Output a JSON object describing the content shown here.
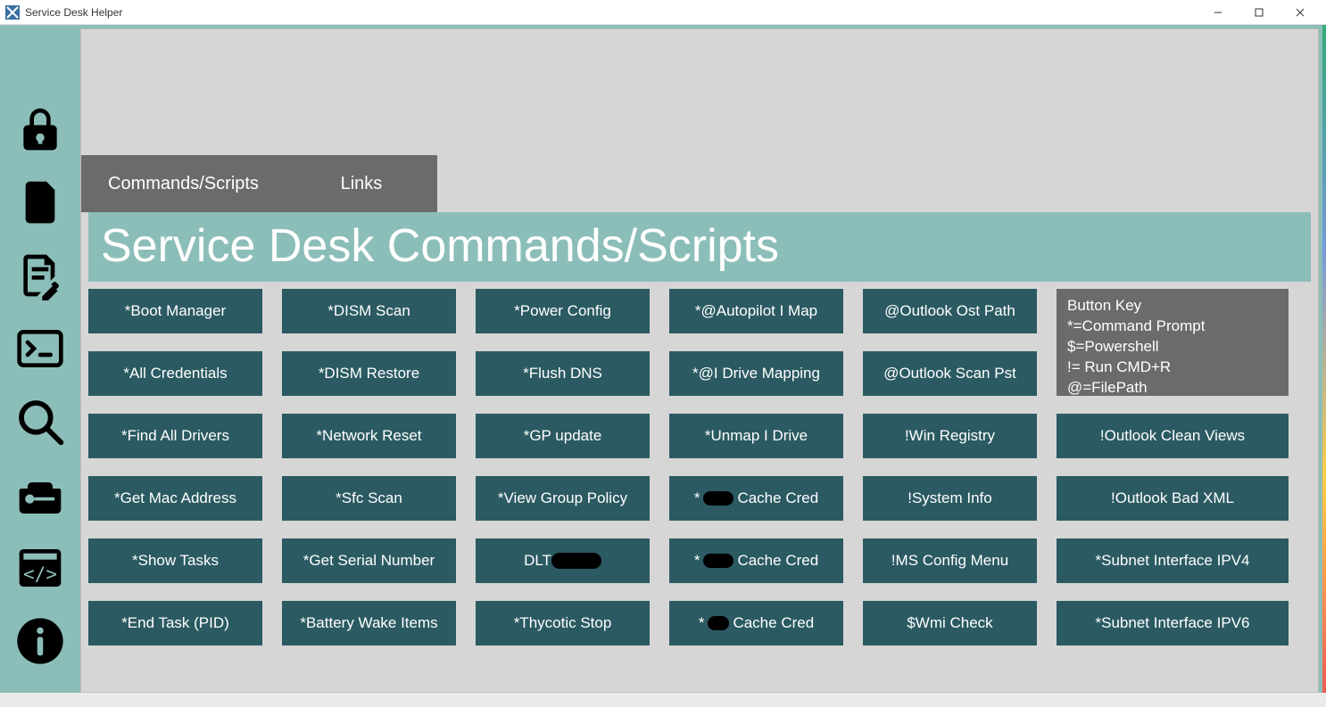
{
  "window": {
    "title": "Service Desk Helper"
  },
  "tabs": {
    "commands": "Commands/Scripts",
    "links": "Links"
  },
  "page": {
    "title": "Service Desk Commands/Scripts"
  },
  "key": {
    "heading": "Button Key",
    "l1": "*=Command Prompt",
    "l2": "$=Powershell",
    "l3": "!= Run CMD+R",
    "l4": "@=FilePath"
  },
  "cols": {
    "c1": [
      "*Boot Manager",
      "*All Credentials",
      "*Find All Drivers",
      "*Get Mac Address",
      "*Show Tasks",
      "*End Task (PID)"
    ],
    "c2": [
      "*DISM Scan",
      "*DISM Restore",
      "*Network Reset",
      "*Sfc Scan",
      "*Get Serial Number",
      "*Battery Wake Items"
    ],
    "c3": [
      "*Power Config",
      "*Flush DNS",
      "*GP update",
      "*View Group Policy",
      "DLT ",
      "*Thycotic Stop"
    ],
    "c4": [
      "*@Autopilot I Map",
      "*@I Drive Mapping",
      "*Unmap I Drive",
      "* Cache Cred",
      "* Cache Cred",
      "* Cache Cred"
    ],
    "c5": [
      "@Outlook Ost Path",
      "@Outlook Scan Pst",
      "!Win Registry",
      "!System Info",
      "!MS Config Menu",
      "$Wmi Check"
    ],
    "c6": [
      "!Outlook Clean Views",
      "!Outlook Bad XML",
      "*Subnet Interface IPV4",
      "*Subnet Interface IPV6"
    ]
  }
}
